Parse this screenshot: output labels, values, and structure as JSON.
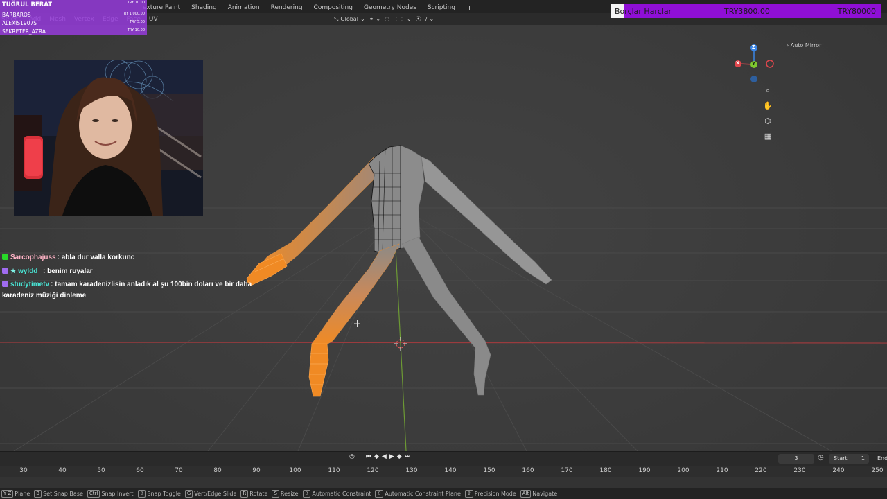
{
  "tabs": [
    "exture Paint",
    "Shading",
    "Animation",
    "Rendering",
    "Compositing",
    "Geometry Nodes",
    "Scripting",
    "+"
  ],
  "menu": [
    "Select",
    "Add",
    "Mesh",
    "Vertex",
    "Edge",
    "Face",
    "UV"
  ],
  "transform": {
    "orientation": "Global"
  },
  "donation": {
    "title": "Borçlar Harçlar",
    "current": "TRY3800.00",
    "goal": "TRY80000"
  },
  "leaderboard": {
    "first": {
      "name": "TUĞRUL BERAT",
      "amount": "TRY 10.00"
    },
    "rows": [
      {
        "name": "BARBAROS",
        "amount": "TRY 1,000.00"
      },
      {
        "name": "ALEXIS1907S",
        "amount": "TRY 5.00"
      },
      {
        "name": "SEKRETER_AZRA",
        "amount": "TRY 10.00"
      }
    ]
  },
  "chat": [
    {
      "user": "Sarcophajuss",
      "user_color": "#ffb3c6",
      "text": ": abla dur valla korkunc",
      "badge": "green"
    },
    {
      "user": "wyldd_",
      "user_color": "#49e7d7",
      "text": ": benim ruyalar",
      "badge": "purple-star"
    },
    {
      "user": "studytimetv",
      "user_color": "#49e7d7",
      "text": ": tamam karadenizlisin anladık al şu 100bin doları ve bir daha karadeniz müziği dinleme",
      "badge": "purple"
    }
  ],
  "viewport": {
    "auto_mirror": "Auto Mirror",
    "gizmo_axes": [
      "X",
      "Y",
      "Z"
    ]
  },
  "timeline": {
    "current_frame": "3",
    "start_label": "Start",
    "start_value": "1",
    "end_label": "End",
    "ruler": [
      "30",
      "40",
      "50",
      "60",
      "70",
      "80",
      "90",
      "100",
      "110",
      "120",
      "130",
      "140",
      "150",
      "160",
      "170",
      "180",
      "190",
      "200",
      "210",
      "220",
      "230",
      "240",
      "250"
    ]
  },
  "statusbar": [
    {
      "key": "Y Z",
      "label": "Plane"
    },
    {
      "key": "B",
      "label": "Set Snap Base"
    },
    {
      "key": "Ctrl",
      "label": "Snap Invert"
    },
    {
      "key": "⇧",
      "label": "Snap Toggle"
    },
    {
      "key": "G",
      "label": "Vert/Edge Slide"
    },
    {
      "key": "R",
      "label": "Rotate"
    },
    {
      "key": "S",
      "label": "Resize"
    },
    {
      "key": "⇧",
      "label": "Automatic Constraint"
    },
    {
      "key": "⇧",
      "label": "Automatic Constraint Plane"
    },
    {
      "key": "⇧",
      "label": "Precision Mode"
    },
    {
      "key": "Alt",
      "label": "Navigate"
    }
  ],
  "colors": {
    "selection": "#f08a24",
    "x_axis": "#e2474d",
    "y_axis": "#7ec82f",
    "z_axis": "#3b86e6",
    "donation": "#8f0fd6"
  }
}
